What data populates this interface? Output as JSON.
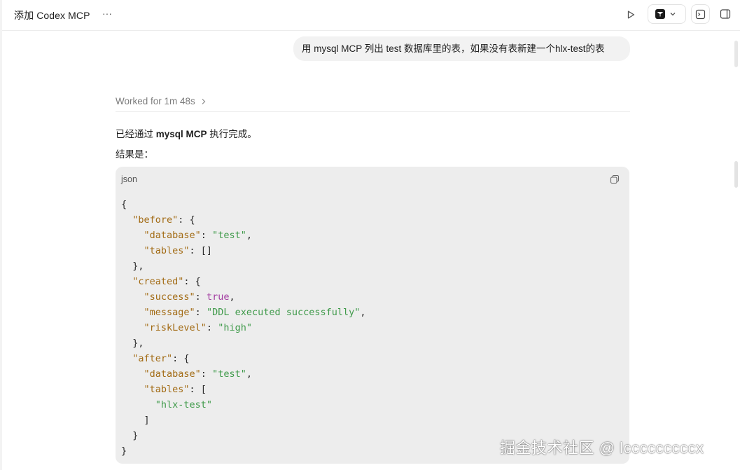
{
  "header": {
    "title": "添加 Codex MCP",
    "more_label": "···",
    "icons": {
      "more": "ellipsis-icon",
      "run": "play-icon",
      "model": "model-logo-icon",
      "dropdown": "chevron-down-icon",
      "terminal": "terminal-icon",
      "panel": "sidebar-toggle-icon"
    }
  },
  "conversation": {
    "user_message": "用 mysql MCP 列出 test 数据库里的表，如果没有表新建一个hlx-test的表",
    "worked_for": "Worked for 1m 48s",
    "answer_prefix": "已经通过 ",
    "answer_bold": "mysql MCP",
    "answer_suffix": " 执行完成。",
    "result_label": "结果是："
  },
  "code_block": {
    "language": "json",
    "copy_icon": "copy-icon",
    "lines": [
      [
        {
          "t": "p",
          "v": "{"
        }
      ],
      [
        {
          "t": "p",
          "v": "  "
        },
        {
          "t": "k",
          "v": "\"before\""
        },
        {
          "t": "p",
          "v": ": {"
        }
      ],
      [
        {
          "t": "p",
          "v": "    "
        },
        {
          "t": "k",
          "v": "\"database\""
        },
        {
          "t": "p",
          "v": ": "
        },
        {
          "t": "s",
          "v": "\"test\""
        },
        {
          "t": "p",
          "v": ","
        }
      ],
      [
        {
          "t": "p",
          "v": "    "
        },
        {
          "t": "k",
          "v": "\"tables\""
        },
        {
          "t": "p",
          "v": ": []"
        }
      ],
      [
        {
          "t": "p",
          "v": "  },"
        }
      ],
      [
        {
          "t": "p",
          "v": "  "
        },
        {
          "t": "k",
          "v": "\"created\""
        },
        {
          "t": "p",
          "v": ": {"
        }
      ],
      [
        {
          "t": "p",
          "v": "    "
        },
        {
          "t": "k",
          "v": "\"success\""
        },
        {
          "t": "p",
          "v": ": "
        },
        {
          "t": "b",
          "v": "true"
        },
        {
          "t": "p",
          "v": ","
        }
      ],
      [
        {
          "t": "p",
          "v": "    "
        },
        {
          "t": "k",
          "v": "\"message\""
        },
        {
          "t": "p",
          "v": ": "
        },
        {
          "t": "s",
          "v": "\"DDL executed successfully\""
        },
        {
          "t": "p",
          "v": ","
        }
      ],
      [
        {
          "t": "p",
          "v": "    "
        },
        {
          "t": "k",
          "v": "\"riskLevel\""
        },
        {
          "t": "p",
          "v": ": "
        },
        {
          "t": "s",
          "v": "\"high\""
        }
      ],
      [
        {
          "t": "p",
          "v": "  },"
        }
      ],
      [
        {
          "t": "p",
          "v": "  "
        },
        {
          "t": "k",
          "v": "\"after\""
        },
        {
          "t": "p",
          "v": ": {"
        }
      ],
      [
        {
          "t": "p",
          "v": "    "
        },
        {
          "t": "k",
          "v": "\"database\""
        },
        {
          "t": "p",
          "v": ": "
        },
        {
          "t": "s",
          "v": "\"test\""
        },
        {
          "t": "p",
          "v": ","
        }
      ],
      [
        {
          "t": "p",
          "v": "    "
        },
        {
          "t": "k",
          "v": "\"tables\""
        },
        {
          "t": "p",
          "v": ": ["
        }
      ],
      [
        {
          "t": "p",
          "v": "      "
        },
        {
          "t": "s",
          "v": "\"hlx-test\""
        }
      ],
      [
        {
          "t": "p",
          "v": "    ]"
        }
      ],
      [
        {
          "t": "p",
          "v": "  }"
        }
      ],
      [
        {
          "t": "p",
          "v": "}"
        }
      ]
    ]
  },
  "watermark": "掘金技术社区 @ lcccccccccx",
  "colors": {
    "key": "#a26b14",
    "string": "#3f9a4a",
    "boolean": "#a23aa0",
    "code_bg": "#ededed",
    "bubble_bg": "#f2f2f2"
  }
}
